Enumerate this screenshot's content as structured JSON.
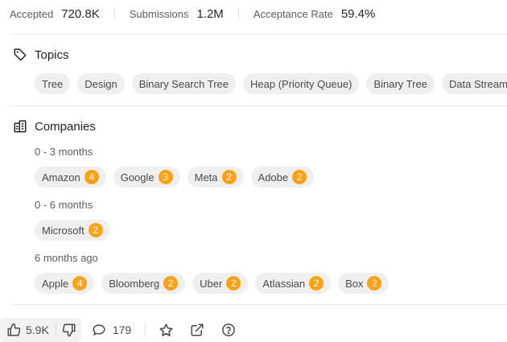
{
  "stats": [
    {
      "label": "Accepted",
      "value": "720.8K"
    },
    {
      "label": "Submissions",
      "value": "1.2M"
    },
    {
      "label": "Acceptance Rate",
      "value": "59.4%"
    }
  ],
  "topics": {
    "title": "Topics",
    "items": [
      "Tree",
      "Design",
      "Binary Search Tree",
      "Heap (Priority Queue)",
      "Binary Tree",
      "Data Stream"
    ]
  },
  "companies": {
    "title": "Companies",
    "groups": [
      {
        "period": "0 - 3 months",
        "items": [
          {
            "name": "Amazon",
            "count": "4"
          },
          {
            "name": "Google",
            "count": "3"
          },
          {
            "name": "Meta",
            "count": "2"
          },
          {
            "name": "Adobe",
            "count": "2"
          }
        ]
      },
      {
        "period": "0 - 6 months",
        "items": [
          {
            "name": "Microsoft",
            "count": "2"
          }
        ]
      },
      {
        "period": "6 months ago",
        "items": [
          {
            "name": "Apple",
            "count": "4"
          },
          {
            "name": "Bloomberg",
            "count": "2"
          },
          {
            "name": "Uber",
            "count": "2"
          },
          {
            "name": "Atlassian",
            "count": "2"
          },
          {
            "name": "Box",
            "count": "2"
          }
        ]
      }
    ]
  },
  "actions": {
    "likes": "5.9K",
    "comments": "179"
  },
  "colors": {
    "badge": "#ffa116",
    "chip_bg": "#efefef"
  },
  "icons": [
    "tag-icon",
    "building-icon",
    "thumbs-up-icon",
    "thumbs-down-icon",
    "comment-icon",
    "star-icon",
    "share-icon",
    "help-icon"
  ]
}
